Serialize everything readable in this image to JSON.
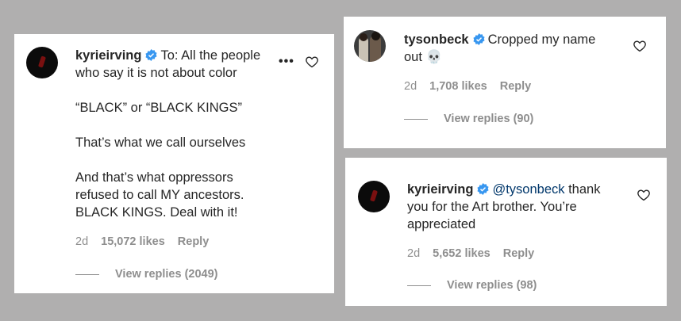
{
  "comments": [
    {
      "username": "kyrieirving",
      "lines": [
        "To: All the people",
        "who say it is not about color",
        "",
        "“BLACK” or “BLACK KINGS”",
        "",
        "That’s what we call ourselves",
        "",
        "And that’s what oppressors",
        "refused to call MY ancestors.",
        "BLACK KINGS. Deal with it!"
      ],
      "age": "2d",
      "likes": "15,072 likes",
      "reply": "Reply",
      "view_replies": "View replies (2049)",
      "more": "•••"
    },
    {
      "username": "tysonbeck",
      "lines": [
        "Cropped my name",
        "out 💀"
      ],
      "age": "2d",
      "likes": "1,708 likes",
      "reply": "Reply",
      "view_replies": "View replies (90)"
    },
    {
      "username": "kyrieirving",
      "mention": "@tysonbeck",
      "lines": [
        " thank",
        "you for the Art brother. You’re",
        "appreciated"
      ],
      "age": "2d",
      "likes": "5,652 likes",
      "reply": "Reply",
      "view_replies": "View replies (98)"
    }
  ],
  "colors": {
    "verified": "#3897f0",
    "mention": "#00376b",
    "muted": "#8e8e8e"
  }
}
